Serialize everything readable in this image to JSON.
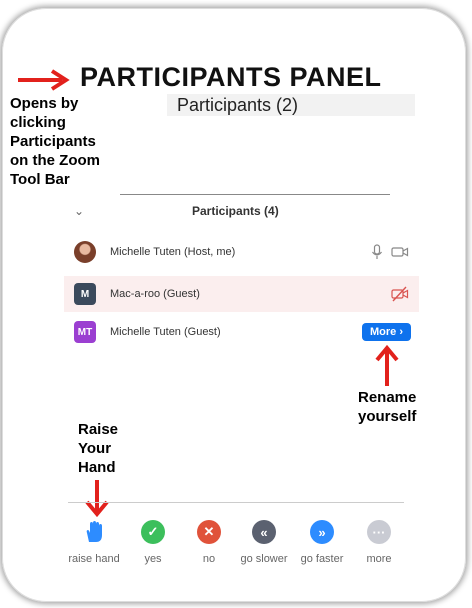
{
  "annotations": {
    "title": "PARTICIPANTS PANEL",
    "opens_lines": [
      "Opens by",
      "clicking",
      "Participants",
      "on the Zoom",
      "Tool Bar"
    ],
    "rename_lines": [
      "Rename",
      "yourself"
    ],
    "raise_lines": [
      "Raise",
      "Your",
      "Hand"
    ]
  },
  "participants_bar": {
    "title": "Participants (2)"
  },
  "panel": {
    "header": "Participants (4)",
    "rows": [
      {
        "name": "Michelle Tuten (Host, me)",
        "avatar": ""
      },
      {
        "name": "Mac-a-roo (Guest)",
        "avatar": "M"
      },
      {
        "name": "Michelle Tuten (Guest)",
        "avatar": "MT",
        "action": "More ›"
      }
    ]
  },
  "toolbar": {
    "items": [
      {
        "label": "raise hand",
        "icon": "hand-icon",
        "color": "#2d8cff"
      },
      {
        "label": "yes",
        "icon": "check-icon",
        "color": "#3cbf5c"
      },
      {
        "label": "no",
        "icon": "x-icon",
        "color": "#e0523a"
      },
      {
        "label": "go slower",
        "icon": "rewind-icon",
        "color": "#5b6170"
      },
      {
        "label": "go faster",
        "icon": "fast-forward-icon",
        "color": "#2d8cff"
      },
      {
        "label": "more",
        "icon": "more-icon",
        "color": "#c9cbd3"
      }
    ]
  },
  "colors": {
    "annotation_arrow": "#e2211c",
    "more_button": "#0e72ed",
    "guest_row_bg": "#fbeeee"
  }
}
